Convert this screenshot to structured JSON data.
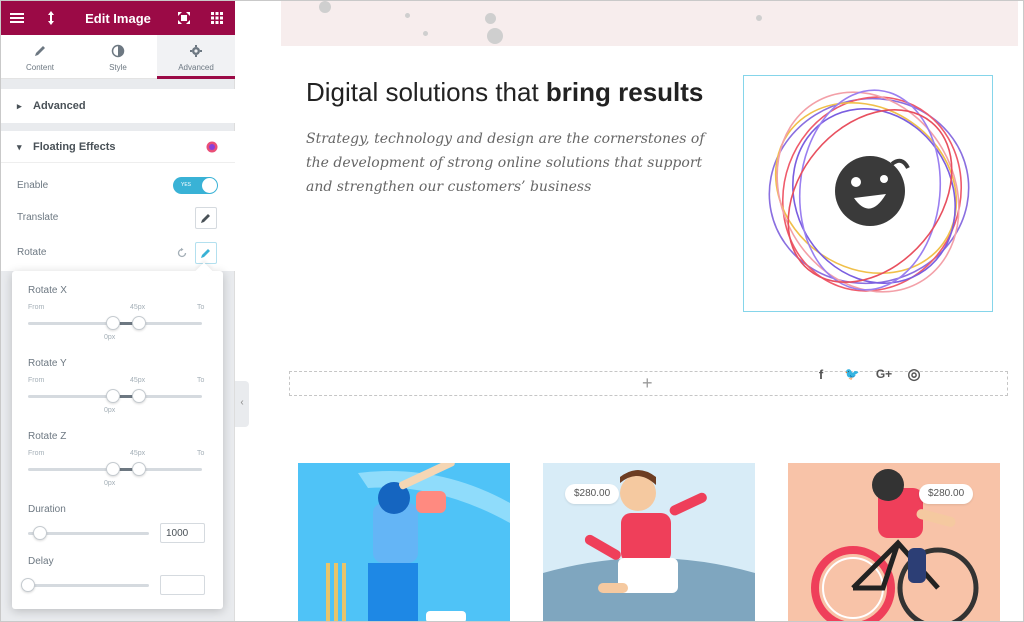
{
  "panel": {
    "title": "Edit Image",
    "tabs": [
      {
        "label": "Content",
        "icon": "pencil-icon"
      },
      {
        "label": "Style",
        "icon": "contrast-icon"
      },
      {
        "label": "Advanced",
        "icon": "gear-icon",
        "active": true
      }
    ],
    "advanced_section": "Advanced",
    "floating_section": "Floating Effects",
    "controls": {
      "enable_label": "Enable",
      "enable_toggle_text": "YES",
      "translate_label": "Translate",
      "rotate_label": "Rotate"
    },
    "accent_color": "#9b0a46",
    "toggle_color": "#39b2d6"
  },
  "rotate_popover": {
    "rotate_x": {
      "label": "Rotate X",
      "from_label": "From",
      "to_label": "To",
      "from_value": "0px",
      "to_value": "45px"
    },
    "rotate_y": {
      "label": "Rotate Y",
      "from_label": "From",
      "to_label": "To",
      "from_value": "0px",
      "to_value": "45px"
    },
    "rotate_z": {
      "label": "Rotate Z",
      "from_label": "From",
      "to_label": "To",
      "from_value": "0px",
      "to_value": "45px"
    },
    "duration": {
      "label": "Duration",
      "value": "1000"
    },
    "delay": {
      "label": "Delay",
      "value": ""
    }
  },
  "canvas": {
    "headline_regular": "Digital solutions that ",
    "headline_bold": "bring results",
    "paragraph": "Strategy, technology and design are the cornerstones of the development of strong online solutions that support and strengthen our customers’ business",
    "add_section_symbol": "+",
    "social_icons": [
      "facebook-icon",
      "twitter-icon",
      "google-plus-icon",
      "dribbble-icon"
    ],
    "social_glyphs": [
      "f",
      "🐦",
      "G+",
      "◎"
    ],
    "cards": [
      {
        "image": "cricket-player-illustration",
        "price": ""
      },
      {
        "image": "soccer-player-illustration",
        "price": "$280.00"
      },
      {
        "image": "cyclist-illustration",
        "price": "$280.00"
      }
    ]
  }
}
